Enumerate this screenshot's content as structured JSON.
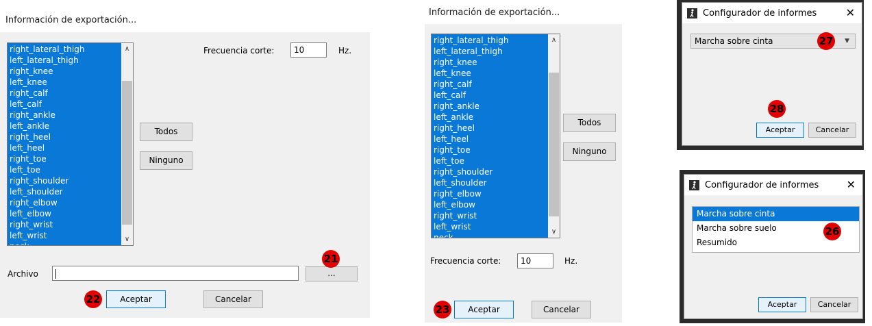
{
  "dialog1": {
    "title": "Información de exportación...",
    "segments": [
      "right_lateral_thigh",
      "left_lateral_thigh",
      "right_knee",
      "left_knee",
      "right_calf",
      "left_calf",
      "right_ankle",
      "left_ankle",
      "right_heel",
      "left_heel",
      "right_toe",
      "left_toe",
      "right_shoulder",
      "left_shoulder",
      "right_elbow",
      "left_elbow",
      "right_wrist",
      "left_wrist",
      "neck"
    ],
    "frecuencia_label": "Frecuencia corte:",
    "frecuencia_value": "10",
    "hz_label": "Hz.",
    "todos_label": "Todos",
    "ninguno_label": "Ninguno",
    "archivo_label": "Archivo",
    "archivo_value": "",
    "browse_label": "...",
    "aceptar_label": "Aceptar",
    "cancelar_label": "Cancelar",
    "badge_browse": "21",
    "badge_aceptar": "22"
  },
  "dialog2": {
    "title": "Información de exportación...",
    "segments": [
      "right_lateral_thigh",
      "left_lateral_thigh",
      "right_knee",
      "left_knee",
      "right_calf",
      "left_calf",
      "right_ankle",
      "left_ankle",
      "right_heel",
      "left_heel",
      "right_toe",
      "left_toe",
      "right_shoulder",
      "left_shoulder",
      "right_elbow",
      "left_elbow",
      "right_wrist",
      "left_wrist",
      "neck"
    ],
    "frecuencia_label": "Frecuencia corte:",
    "frecuencia_value": "10",
    "hz_label": "Hz.",
    "todos_label": "Todos",
    "ninguno_label": "Ninguno",
    "aceptar_label": "Aceptar",
    "cancelar_label": "Cancelar",
    "badge_aceptar": "23"
  },
  "config_top": {
    "title": "Configurador de informes",
    "close": "✕",
    "combo_value": "Marcha sobre cinta",
    "aceptar_label": "Aceptar",
    "cancelar_label": "Cancelar",
    "badge_combo": "27",
    "badge_aceptar": "28"
  },
  "config_bottom": {
    "title": "Configurador de informes",
    "close": "✕",
    "options": [
      "Marcha sobre cinta",
      "Marcha sobre suelo",
      "Resumido"
    ],
    "selected_index": 0,
    "aceptar_label": "Aceptar",
    "cancelar_label": "Cancelar",
    "badge_list": "26"
  },
  "colors": {
    "selection": "#0a78d7",
    "badge": "#e20000",
    "panel": "#f0f0f0"
  },
  "icons": {
    "scroll_up": "chevron-up-icon",
    "scroll_down": "chevron-down-icon",
    "combo_arrow": "caret-down-icon",
    "app_icon": "walking-figure-icon",
    "close": "close-icon"
  }
}
